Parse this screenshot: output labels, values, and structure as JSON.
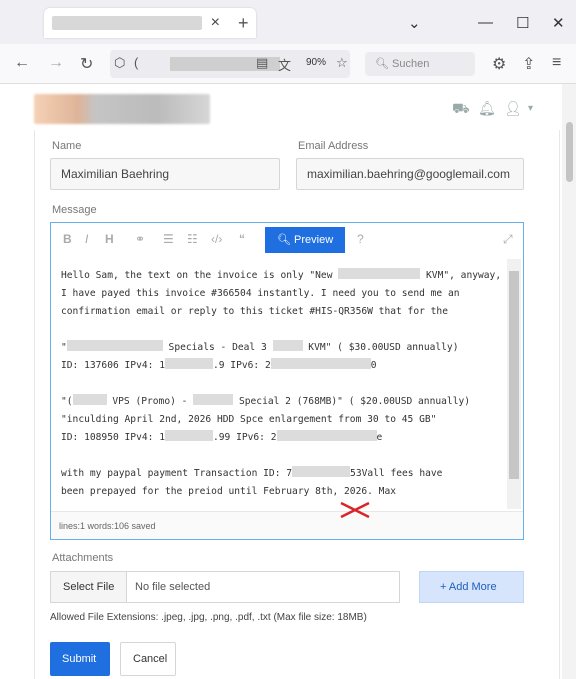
{
  "browser": {
    "close_glyph": "×",
    "newtab_glyph": "+",
    "dropdown_glyph": "⌄",
    "minimize_glyph": "—",
    "maximize_glyph": "☐",
    "window_close_glyph": "✕",
    "zoom": "90%",
    "search_placeholder": "Suchen"
  },
  "form": {
    "name_label": "Name",
    "name_value": "Maximilian Baehring",
    "email_label": "Email Address",
    "email_value": "maximilian.baehring@googlemail.com",
    "message_label": "Message",
    "preview_label": "Preview",
    "message_lines": {
      "l1a": "Hello Sam, the text on the invoice is only \"New ",
      "l1b": " KVM\", anyway,",
      "l2": "I have payed this invoice #366504 instantly. I need you to send me an",
      "l3": "confirmation email or reply to this ticket #HIS-QR356W that for the",
      "l5a": "\"",
      "l5b": " Specials - Deal 3 ",
      "l5c": " KVM\" ( $30.00USD annually)",
      "l6a": "ID: 137606 IPv4: 1",
      "l6b": ".9 IPv6: 2",
      "l6c": "0",
      "l8a": "\"(",
      "l8b": " VPS (Promo) - ",
      "l8c": " Special 2 (768MB)\" ( $20.00USD annually)",
      "l9": "\"inculding April 2nd, 2026 HDD Spce enlargement from 30 to 45 GB\"",
      "l10a": "ID: 108950 IPv4: 1",
      "l10b": ".99 IPv6: 2",
      "l10c": "e",
      "l12a": "with my paypal payment Transaction ID: 7",
      "l12b": "53Vall fees have",
      "l13": "been prepayed for the preiod until February 8th, 2026. Max"
    },
    "status_text": "lines:1 words:106 saved",
    "attachments_label": "Attachments",
    "select_file_label": "Select File",
    "no_file_label": "No file selected",
    "add_more_label": "+ Add More",
    "extensions_note": "Allowed File Extensions: .jpeg, .jpg, .png, .pdf, .txt (Max file size: 18MB)",
    "submit_label": "Submit",
    "cancel_label": "Cancel"
  },
  "colors": {
    "primary": "#1f6fe0",
    "add_more_bg": "#d6e5fb",
    "editor_border": "#66afe9",
    "annotation_red": "#d9262b"
  }
}
